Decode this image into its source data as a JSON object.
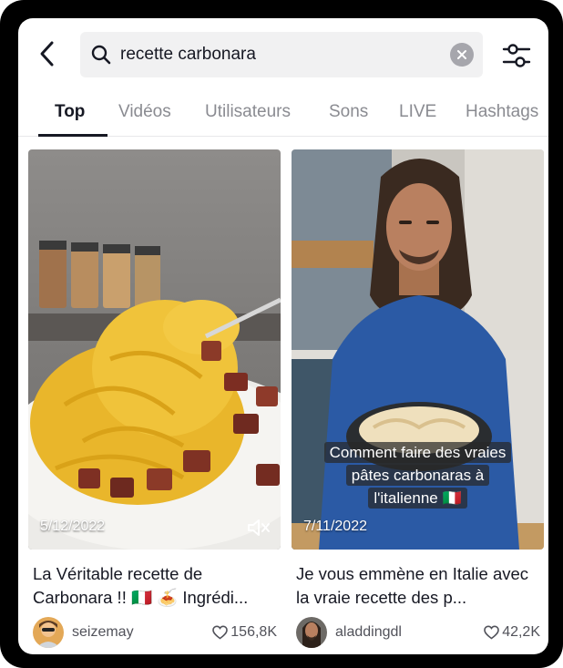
{
  "search": {
    "query": "recette carbonara"
  },
  "tabs": [
    {
      "label": "Top",
      "active": true
    },
    {
      "label": "Vidéos",
      "active": false
    },
    {
      "label": "Utilisateurs",
      "active": false
    },
    {
      "label": "Sons",
      "active": false
    },
    {
      "label": "LIVE",
      "active": false
    },
    {
      "label": "Hashtags",
      "active": false
    }
  ],
  "results": [
    {
      "date": "5/12/2022",
      "title": "La Véritable recette de Carbonara !! 🇮🇹 🍝 Ingrédi...",
      "username": "seizemay",
      "likes": "156,8K",
      "muted": true
    },
    {
      "date": "7/11/2022",
      "caption_line1": "Comment faire des vraies",
      "caption_line2": "pâtes carbonaras à",
      "caption_line3": "l'italienne 🇮🇹",
      "title": "Je vous emmène en Italie avec la vraie recette des p...",
      "username": "aladdingdl",
      "likes": "42,2K"
    }
  ],
  "colors": {
    "text": "#161823",
    "muted_text": "#8a8b91",
    "search_bg": "#f1f1f2"
  }
}
